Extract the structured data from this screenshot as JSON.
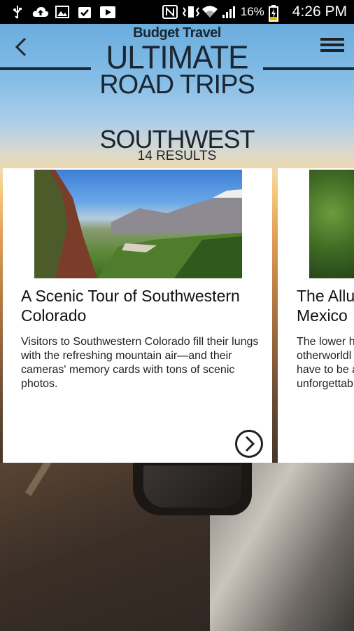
{
  "status_bar": {
    "left_icons": [
      "usb-icon",
      "cloud-upload-icon",
      "image-icon",
      "clipboard-check-icon",
      "play-icon"
    ],
    "right_icons": [
      "nfc-icon",
      "vibrate-icon",
      "wifi-icon",
      "signal-icon",
      "battery-icon"
    ],
    "battery_percent": "16%",
    "time": "4:26 PM"
  },
  "header": {
    "brand": "Budget Travel",
    "title_line1": "ULTIMATE",
    "title_line2": "ROAD TRIPS",
    "back_icon": "chevron-left-icon",
    "menu_icon": "hamburger-menu-icon"
  },
  "section": {
    "region": "SOUTHWEST",
    "results": "14 RESULTS"
  },
  "cards": [
    {
      "title": "A Scenic Tour of Southwestern Colorado",
      "description": "Visitors to Southwestern Colorado fill their lungs with the refreshing mountain air—and their cameras' memory cards with tons of scenic photos.",
      "arrow_icon": "chevron-right-circle-icon"
    },
    {
      "title_lines": [
        "The Allu",
        "Mexico"
      ],
      "description_lines": [
        "The lower h",
        "otherworldl",
        "have to be a",
        "unforgettab"
      ]
    }
  ],
  "colors": {
    "title": "#1b2630",
    "status_bar_bg": "#000000",
    "card_bg": "#ffffff"
  }
}
